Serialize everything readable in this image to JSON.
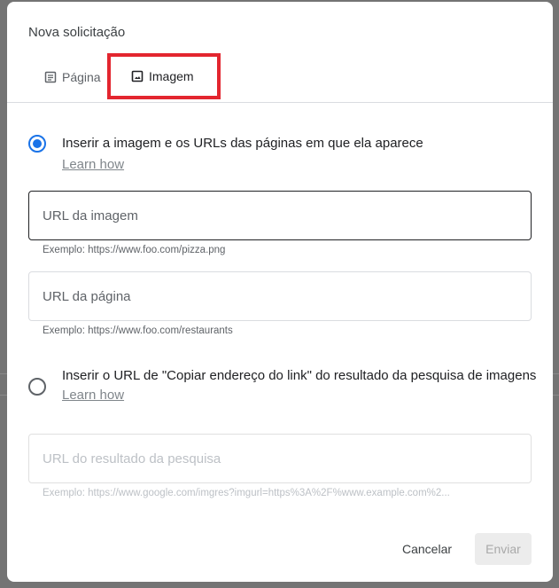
{
  "dialog": {
    "title": "Nova solicitação"
  },
  "tabs": [
    {
      "label": "Página",
      "icon": "document-icon",
      "selected": false
    },
    {
      "label": "Imagem",
      "icon": "image-icon",
      "selected": true,
      "highlighted": true
    }
  ],
  "options": [
    {
      "label": "Inserir a imagem e os URLs das páginas em que ela aparece",
      "learn_link": "Learn how",
      "checked": true
    },
    {
      "label": "Inserir o URL de \"Copiar endereço do link\" do resultado da pesquisa de imagens",
      "learn_link": "Learn how",
      "checked": false
    }
  ],
  "fields": {
    "image_url": {
      "placeholder": "URL da imagem",
      "value": "",
      "hint": "Exemplo: https://www.foo.com/pizza.png"
    },
    "page_url": {
      "placeholder": "URL da página",
      "value": "",
      "hint": "Exemplo: https://www.foo.com/restaurants"
    },
    "search_result_url": {
      "placeholder": "URL do resultado da pesquisa",
      "value": "",
      "hint": "Exemplo: https://www.google.com/imgres?imgurl=https%3A%2F%www.example.com%2...",
      "disabled": true
    }
  },
  "actions": {
    "cancel_label": "Cancelar",
    "send_label": "Enviar"
  },
  "colors": {
    "accent": "#1a73e8",
    "highlight_box": "#e3262f",
    "backdrop": "#747474"
  }
}
